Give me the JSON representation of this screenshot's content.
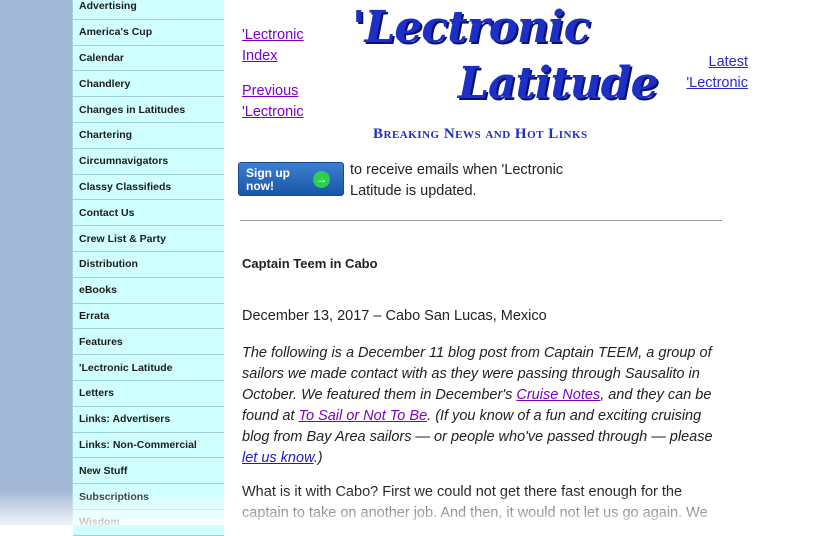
{
  "sidebar": {
    "items": [
      {
        "label": "Advertising"
      },
      {
        "label": "America's Cup"
      },
      {
        "label": "Calendar"
      },
      {
        "label": "Chandlery"
      },
      {
        "label": "Changes in Latitudes"
      },
      {
        "label": "Chartering"
      },
      {
        "label": "Circumnavigators"
      },
      {
        "label": "Classy Classifieds"
      },
      {
        "label": "Contact Us"
      },
      {
        "label": "Crew List & Party"
      },
      {
        "label": "Distribution"
      },
      {
        "label": "eBooks"
      },
      {
        "label": "Errata"
      },
      {
        "label": "Features"
      },
      {
        "label": "'Lectronic Latitude"
      },
      {
        "label": "Letters"
      },
      {
        "label": "Links: Advertisers"
      },
      {
        "label": "Links: Non-Commercial"
      },
      {
        "label": "New Stuff"
      },
      {
        "label": "Subscriptions"
      },
      {
        "label": "Wisdom"
      }
    ]
  },
  "header": {
    "index_link": "'Lectronic Index",
    "previous_link": "Previous 'Lectronic",
    "latest_link": "Latest 'Lectronic",
    "logo_line1": "'Lectronic",
    "logo_line2": "Latitude",
    "tagline": "Breaking News and Hot Links"
  },
  "signup": {
    "button_label": "Sign up now!",
    "arrow_icon": "→",
    "description": "to receive emails when 'Lectronic Latitude is updated."
  },
  "article": {
    "title": "Captain Teem in Cabo",
    "dateline": "December 13, 2017 – Cabo San Lucas, Mexico",
    "intro_part1": "The following is a December 11 blog post from Captain TEEM, a group of sailors we made contact with as they were passing through Sausalito in October. We featured them in December's ",
    "intro_link1": "Cruise Notes",
    "intro_part2": ", and they can be found at ",
    "intro_link2": "To Sail or Not To Be",
    "intro_part3": ". (If you know of a fun and exciting cruising blog from Bay Area sailors — or people who've passed through — please ",
    "intro_link3": "let us know",
    "intro_part4": ".)",
    "body": "What is it with Cabo? First we could not get there fast enough for the captain to take on another job. And then, it would not let us go again. We"
  },
  "colors": {
    "sidebar_bg": "#cfffff",
    "logo_blue": "#1d2fc4",
    "visited_link": "#7d00c8",
    "link": "#1c1cc8"
  }
}
